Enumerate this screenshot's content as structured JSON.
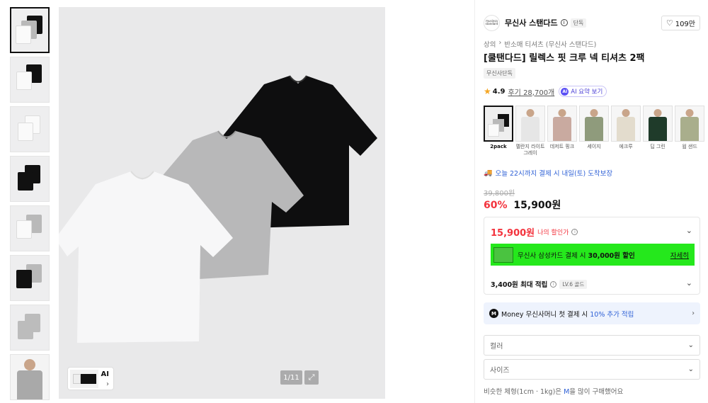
{
  "gallery": {
    "counter": "1/11",
    "ai_label": "AI",
    "thumbnail_count": 8
  },
  "brand": {
    "logo_text": "musinsa standard",
    "name": "무신사 스탠다드",
    "exclusive_tag": "단독",
    "likes": "109만"
  },
  "breadcrumb": [
    "상의",
    "›",
    "반소매 티셔츠 (무신사 스탠다드)"
  ],
  "product": {
    "title": "[쿨탠다드] 릴렉스 핏 크루 넥 티셔츠 2팩",
    "badge": "무신사단독",
    "rating": "4.9",
    "reviews": "후기 28,700개",
    "ai_summary": "AI 요약 보기",
    "ai_icon": "AI"
  },
  "colors": [
    {
      "name": "2pack"
    },
    {
      "name": "멜란지 라이트 그레이"
    },
    {
      "name": "데저트 핑크"
    },
    {
      "name": "세이지"
    },
    {
      "name": "에크루"
    },
    {
      "name": "딥 그린"
    },
    {
      "name": "웜 샌드"
    }
  ],
  "delivery": "오늘 22시까지 결제 시 내일(토) 도착보장",
  "price": {
    "original": "39,800원",
    "discount": "60%",
    "sale": "15,900원"
  },
  "benefits": {
    "my_price": "15,900원",
    "my_price_label": "나의 할인가",
    "card_promo_prefix": "무신사 삼성카드 결제 시",
    "card_promo_bold": "30,000원 할인",
    "card_promo_detail": "자세히",
    "points": "3,400원 최대 적립",
    "level": "LV.6 골드"
  },
  "money": {
    "logo": "M",
    "prefix": "Money 무신사머니 첫 결제 시",
    "highlight": "10% 추가 적립"
  },
  "options": {
    "color_placeholder": "컬러",
    "size_placeholder": "사이즈"
  },
  "similar": {
    "prefix": "비슷한 체형(1cm · 1kg)은",
    "size": "M",
    "suffix": "을 많이 구매했어요"
  },
  "accent_colors": {
    "sale_red": "#f3333d",
    "link_blue": "#2f61d6",
    "promo_green": "#25e81c"
  }
}
